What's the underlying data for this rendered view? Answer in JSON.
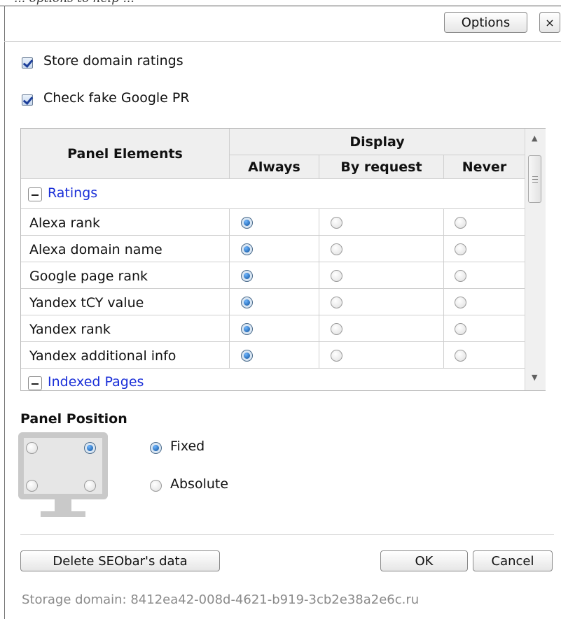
{
  "header": {
    "clipped_text": "... options to help ...",
    "options_label": "Options",
    "close_label": "×"
  },
  "settings": {
    "store_ratings_label": "Store domain ratings",
    "store_ratings_checked": true,
    "fake_pr_label": "Check fake Google PR",
    "fake_pr_checked": true
  },
  "grid": {
    "col_panel_elements": "Panel Elements",
    "col_display": "Display",
    "col_always": "Always",
    "col_by_request": "By request",
    "col_never": "Never",
    "groups": [
      {
        "label": "Ratings",
        "rows": [
          {
            "label": "Alexa rank",
            "selected": "Always"
          },
          {
            "label": "Alexa domain name",
            "selected": "Always"
          },
          {
            "label": "Google page rank",
            "selected": "Always"
          },
          {
            "label": "Yandex tCY value",
            "selected": "Always"
          },
          {
            "label": "Yandex rank",
            "selected": "Always"
          },
          {
            "label": "Yandex additional info",
            "selected": "Always"
          }
        ]
      },
      {
        "label": "Indexed Pages",
        "rows": []
      }
    ]
  },
  "position": {
    "title": "Panel Position",
    "corner_selected": "top-right",
    "fixed_label": "Fixed",
    "absolute_label": "Absolute",
    "mode_selected": "Fixed"
  },
  "footer": {
    "delete_label": "Delete SEObar's data",
    "ok_label": "OK",
    "cancel_label": "Cancel",
    "storage_text": "Storage domain: 8412ea42-008d-4621-b919-3cb2e38a2e6c.ru"
  }
}
